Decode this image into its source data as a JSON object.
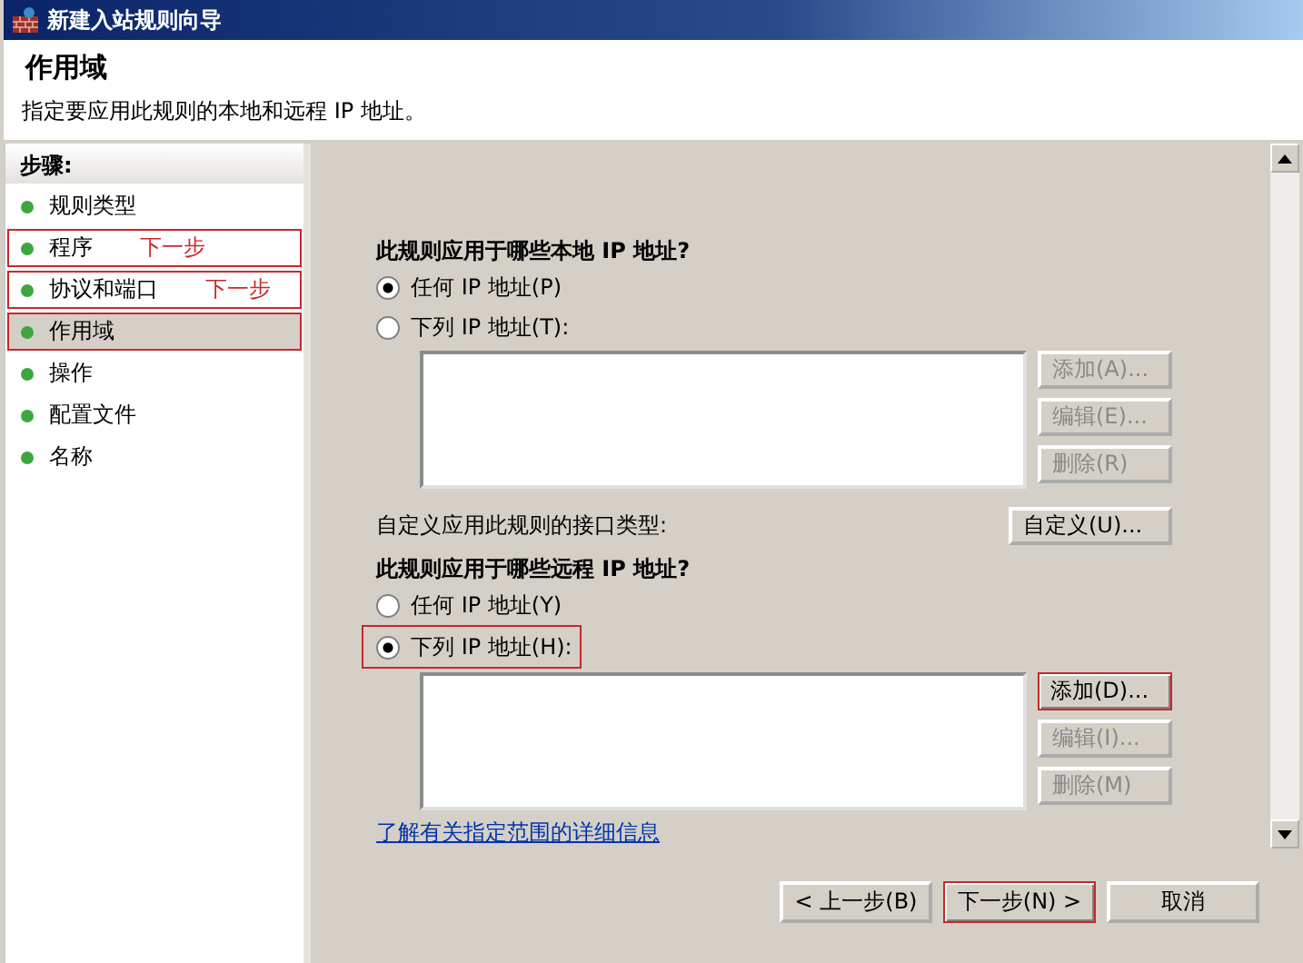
{
  "window": {
    "title": "新建入站规则向导"
  },
  "header": {
    "title": "作用域",
    "subtitle": "指定要应用此规则的本地和远程 IP 地址。"
  },
  "steps": {
    "heading": "步骤:",
    "items": [
      {
        "label": "规则类型",
        "selected": false,
        "highlighted": false
      },
      {
        "label": "程序",
        "selected": false,
        "highlighted": true,
        "note": "下一步"
      },
      {
        "label": "协议和端口",
        "selected": false,
        "highlighted": true,
        "note": "下一步"
      },
      {
        "label": "作用域",
        "selected": true,
        "highlighted": true
      },
      {
        "label": "操作",
        "selected": false,
        "highlighted": false
      },
      {
        "label": "配置文件",
        "selected": false,
        "highlighted": false
      },
      {
        "label": "名称",
        "selected": false,
        "highlighted": false
      }
    ]
  },
  "local": {
    "question": "此规则应用于哪些本地 IP 地址?",
    "options": [
      {
        "label": "任何 IP 地址(P)",
        "selected": true,
        "highlighted": false
      },
      {
        "label": "下列 IP 地址(T):",
        "selected": false,
        "highlighted": false
      }
    ],
    "buttons": [
      {
        "label": "添加(A)...",
        "disabled": true,
        "highlighted": false
      },
      {
        "label": "编辑(E)...",
        "disabled": true,
        "highlighted": false
      },
      {
        "label": "删除(R)",
        "disabled": true,
        "highlighted": false
      }
    ]
  },
  "interface": {
    "label": "自定义应用此规则的接口类型:",
    "button": "自定义(U)..."
  },
  "remote": {
    "question": "此规则应用于哪些远程 IP 地址?",
    "options": [
      {
        "label": "任何 IP 地址(Y)",
        "selected": false,
        "highlighted": false
      },
      {
        "label": "下列 IP 地址(H):",
        "selected": true,
        "highlighted": true
      }
    ],
    "buttons": [
      {
        "label": "添加(D)...",
        "disabled": false,
        "highlighted": true
      },
      {
        "label": "编辑(I)...",
        "disabled": true,
        "highlighted": false
      },
      {
        "label": "删除(M)",
        "disabled": true,
        "highlighted": false
      }
    ]
  },
  "link": "了解有关指定范围的详细信息",
  "footer_buttons": [
    {
      "label": "< 上一步(B)",
      "highlighted": false
    },
    {
      "label": "下一步(N) >",
      "highlighted": true
    },
    {
      "label": "取消",
      "highlighted": false
    }
  ]
}
